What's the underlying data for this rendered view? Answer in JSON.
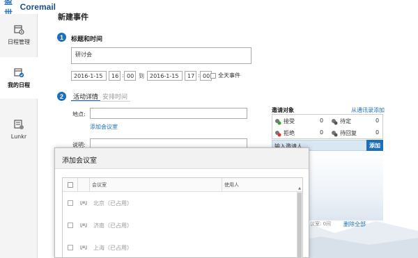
{
  "brand": {
    "cn": "盈世",
    "en": "Coremail"
  },
  "sidebar": {
    "items": [
      {
        "label": "日程管理"
      },
      {
        "label": "我的日程"
      },
      {
        "label": "Lunkr"
      }
    ]
  },
  "page": {
    "title": "新建事件"
  },
  "step1": {
    "num": "1",
    "title": "标题和时间",
    "subject": "研讨会",
    "start_date": "2016-1-15",
    "start_hour": "16",
    "start_min": "00",
    "to_label": "到",
    "end_date": "2016-1-15",
    "end_hour": "17",
    "end_min": "00",
    "colon": ":",
    "allday_label": "全天事件"
  },
  "step2": {
    "num": "2",
    "tabs": [
      {
        "label": "活动详情"
      },
      {
        "label": "安排时间"
      }
    ],
    "location_label": "地点:",
    "add_room_link": "添加会议室",
    "desc_label": "说明:"
  },
  "invite": {
    "title": "邀请对象",
    "from_contacts": "从通讯录添加",
    "accept_label": "接受",
    "accept_count": "0",
    "pending_label": "待定",
    "pending_count": "0",
    "reject_label": "拒绝",
    "reject_count": "0",
    "await_label": "待回复",
    "await_count": "0",
    "input_placeholder": "输入邀请人",
    "add_button": "添加",
    "room_count": "议室: 0间",
    "delete_all": "删除全部"
  },
  "modal": {
    "title": "添加会议室",
    "col_room": "会议室",
    "col_user": "使用人",
    "rows": [
      {
        "name": "北京（已占用）"
      },
      {
        "name": "济南（已占用）"
      },
      {
        "name": "上海（已占用）"
      }
    ]
  },
  "colors": {
    "accent": "#1c6fb8",
    "brand": "#2a76c2"
  }
}
